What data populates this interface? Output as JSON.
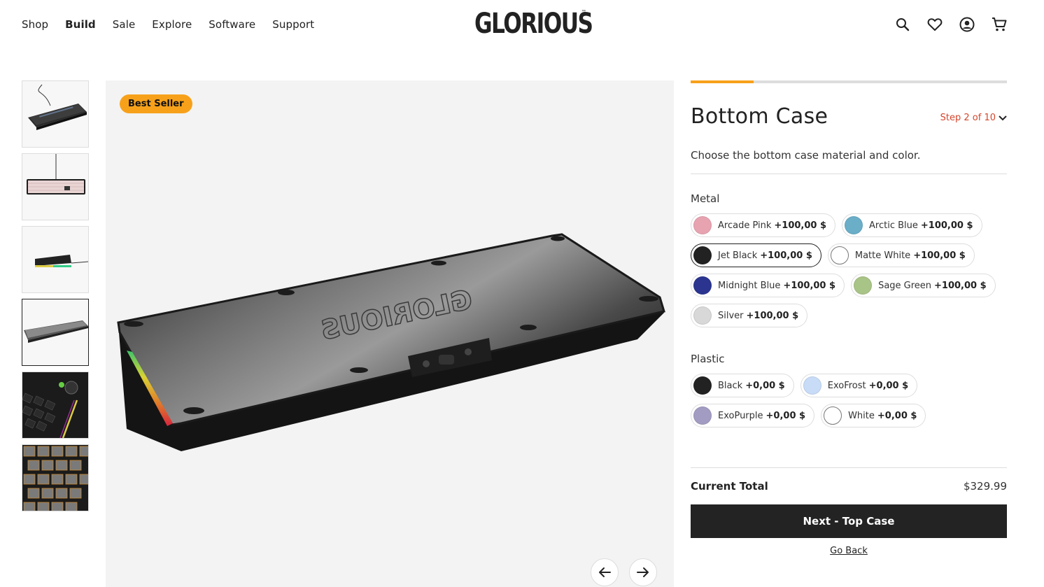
{
  "nav": {
    "items": [
      {
        "label": "Shop",
        "active": false
      },
      {
        "label": "Build",
        "active": true
      },
      {
        "label": "Sale",
        "active": false
      },
      {
        "label": "Explore",
        "active": false
      },
      {
        "label": "Software",
        "active": false
      },
      {
        "label": "Support",
        "active": false
      }
    ]
  },
  "logo": {
    "text": "GLORIOUS",
    "tm": "™"
  },
  "header_icons": [
    "search-icon",
    "heart-icon",
    "account-icon",
    "cart-icon"
  ],
  "product": {
    "badge": "Best Seller",
    "thumbnails": [
      "keyboard-angled",
      "keyboard-top",
      "keyboard-side",
      "bottom-case",
      "knob-closeup",
      "keycaps-closeup"
    ],
    "selected_thumbnail": 3
  },
  "panel": {
    "progress": 0.2,
    "title": "Bottom Case",
    "step": "Step 2 of 10",
    "description": "Choose the bottom case material and color.",
    "groups": [
      {
        "label": "Metal",
        "options": [
          {
            "name": "Arcade Pink",
            "price": "+100,00 $",
            "color": "#e8a3b0",
            "selected": false
          },
          {
            "name": "Arctic Blue",
            "price": "+100,00 $",
            "color": "#6aaec8",
            "selected": false
          },
          {
            "name": "Jet Black",
            "price": "+100,00 $",
            "color": "#222222",
            "selected": true
          },
          {
            "name": "Matte White",
            "price": "+100,00 $",
            "color": "#ffffff",
            "selected": false
          },
          {
            "name": "Midnight Blue",
            "price": "+100,00 $",
            "color": "#2b3590",
            "selected": false
          },
          {
            "name": "Sage Green",
            "price": "+100,00 $",
            "color": "#a9c487",
            "selected": false
          },
          {
            "name": "Silver",
            "price": "+100,00 $",
            "color": "#d8d8d8",
            "selected": false
          }
        ]
      },
      {
        "label": "Plastic",
        "options": [
          {
            "name": "Black",
            "price": "+0,00 $",
            "color": "#222222",
            "selected": false
          },
          {
            "name": "ExoFrost",
            "price": "+0,00 $",
            "color": "#c8dcf8",
            "selected": false
          },
          {
            "name": "ExoPurple",
            "price": "+0,00 $",
            "color": "#a39cc2",
            "selected": false
          },
          {
            "name": "White",
            "price": "+0,00 $",
            "color": "#ffffff",
            "selected": false
          }
        ]
      }
    ],
    "total_label": "Current Total",
    "total_value": "$329.99",
    "next_label": "Next - Top Case",
    "back_label": "Go Back"
  },
  "colors": {
    "accent": "#f7a11b",
    "step": "#d6452c",
    "button": "#232323"
  }
}
